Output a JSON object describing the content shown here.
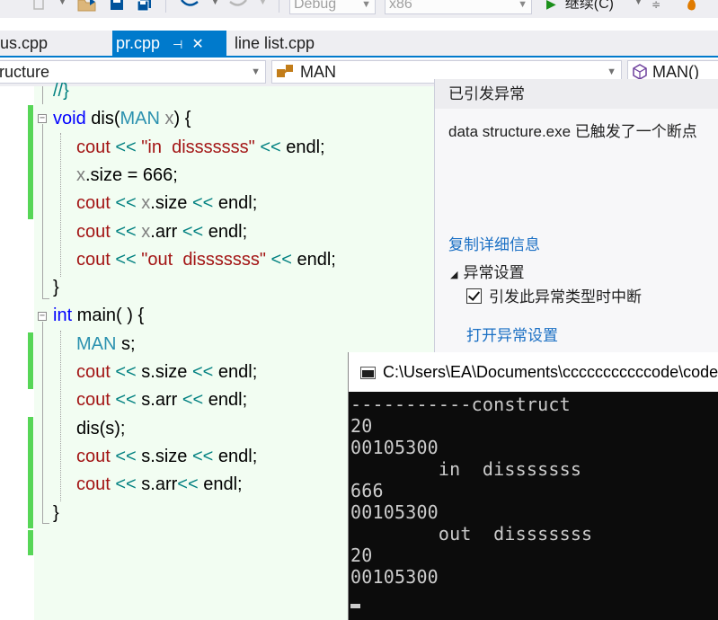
{
  "toolbar": {
    "config": "Debug",
    "platform": "x86",
    "run_label": "继续(C)"
  },
  "tabs": [
    {
      "label": "us.cpp",
      "active": false
    },
    {
      "label": "pr.cpp",
      "active": true
    },
    {
      "label": "line list.cpp",
      "active": false
    }
  ],
  "nav": {
    "scope": "ructure",
    "type": "MAN",
    "member": "MAN()"
  },
  "code_lines": [
    {
      "indent": 0,
      "html": "<span class=\"op\">//}</span>"
    },
    {
      "indent": 0,
      "html": "<span class=\"kw\">void</span> dis(<span class=\"ty\">MAN</span> <span class=\"par\">x</span>) {"
    },
    {
      "indent": 1,
      "html": "<span class=\"cout\">cout</span> <span class=\"op\">&lt;&lt;</span> <span class=\"str\">\"in  disssssss\"</span> <span class=\"op\">&lt;&lt;</span> endl;"
    },
    {
      "indent": 1,
      "html": "<span class=\"par\">x</span>.size = 666;"
    },
    {
      "indent": 1,
      "html": "<span class=\"cout\">cout</span> <span class=\"op\">&lt;&lt;</span> <span class=\"par\">x</span>.size <span class=\"op\">&lt;&lt;</span> endl;"
    },
    {
      "indent": 1,
      "html": "<span class=\"cout\">cout</span> <span class=\"op\">&lt;&lt;</span> <span class=\"par\">x</span>.arr <span class=\"op\">&lt;&lt;</span> endl;"
    },
    {
      "indent": 1,
      "html": "<span class=\"cout\">cout</span> <span class=\"op\">&lt;&lt;</span> <span class=\"str\">\"out  disssssss\"</span> <span class=\"op\">&lt;&lt;</span> endl;"
    },
    {
      "indent": 0,
      "html": "}"
    },
    {
      "indent": 0,
      "html": "<span class=\"kw\">int</span> main( ) {"
    },
    {
      "indent": 1,
      "html": "<span class=\"ty\">MAN</span> s;"
    },
    {
      "indent": 1,
      "html": "<span class=\"cout\">cout</span> <span class=\"op\">&lt;&lt;</span> s.size <span class=\"op\">&lt;&lt;</span> endl;"
    },
    {
      "indent": 1,
      "html": "<span class=\"cout\">cout</span> <span class=\"op\">&lt;&lt;</span> s.arr <span class=\"op\">&lt;&lt;</span> endl;"
    },
    {
      "indent": 1,
      "html": "dis(s);"
    },
    {
      "indent": 1,
      "html": "<span class=\"cout\">cout</span> <span class=\"op\">&lt;&lt;</span> s.size <span class=\"op\">&lt;&lt;</span> endl;"
    },
    {
      "indent": 1,
      "html": "<span class=\"cout\">cout</span> <span class=\"op\">&lt;&lt;</span> s.arr<span class=\"op\">&lt;&lt;</span> endl;"
    },
    {
      "indent": 0,
      "html": "}"
    }
  ],
  "exception": {
    "title": "已引发异常",
    "message": "data structure.exe 已触发了一个断点",
    "copy_details": "复制详细信息",
    "settings_header": "异常设置",
    "break_on_type": "引发此异常类型时中断",
    "break_checked": true,
    "open_settings": "打开异常设置"
  },
  "console": {
    "title": "C:\\Users\\EA\\Documents\\cccccccccccode\\code",
    "lines": [
      "-----------construct",
      "20",
      "00105300",
      "        in  disssssss",
      "666",
      "00105300",
      "        out  disssssss",
      "20",
      "00105300"
    ]
  }
}
